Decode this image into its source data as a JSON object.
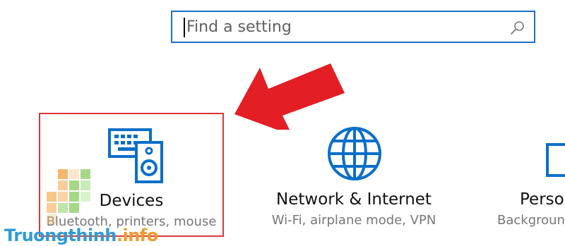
{
  "search": {
    "placeholder": "Find a setting"
  },
  "tiles": [
    {
      "title": "Devices",
      "subtitle": "Bluetooth, printers, mouse",
      "icon": "devices-icon",
      "selected": true
    },
    {
      "title": "Network & Internet",
      "subtitle": "Wi-Fi, airplane mode, VPN",
      "icon": "globe-icon",
      "selected": false
    },
    {
      "title": "Perso",
      "subtitle": "Backgroun",
      "icon": "personalization-icon",
      "selected": false
    }
  ],
  "watermark": {
    "name": "Truongthinh",
    "tld": ".info"
  },
  "colors": {
    "accent": "#1f6fc5",
    "highlight_border": "#d9383a",
    "arrow": "#e31e24"
  }
}
